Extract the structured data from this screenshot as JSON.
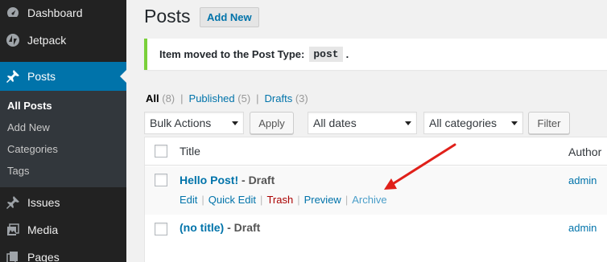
{
  "sidebar": {
    "items": [
      {
        "label": "Dashboard",
        "icon": "dashboard-icon"
      },
      {
        "label": "Jetpack",
        "icon": "jetpack-icon"
      },
      {
        "label": "Posts",
        "icon": "pin-icon"
      },
      {
        "label": "Issues",
        "icon": "pin-icon"
      },
      {
        "label": "Media",
        "icon": "media-icon"
      },
      {
        "label": "Pages",
        "icon": "pages-icon"
      }
    ],
    "submenu": [
      "All Posts",
      "Add New",
      "Categories",
      "Tags"
    ],
    "accent": "#0073aa"
  },
  "header": {
    "title": "Posts",
    "add_new": "Add New"
  },
  "notice": {
    "text": "Item moved to the Post Type:",
    "code": "post",
    "suffix": ".",
    "border_color": "#7ad03a"
  },
  "filters": {
    "all": "All",
    "all_count": "(8)",
    "published": "Published",
    "published_count": "(5)",
    "drafts": "Drafts",
    "drafts_count": "(3)",
    "separator": "|"
  },
  "tablenav": {
    "bulk_actions": "Bulk Actions",
    "apply": "Apply",
    "dates": "All dates",
    "categories": "All categories",
    "filter": "Filter"
  },
  "table": {
    "columns": {
      "title": "Title",
      "author": "Author"
    },
    "rows": [
      {
        "title": "Hello Post!",
        "state": "- Draft",
        "author": "admin",
        "actions": [
          "Edit",
          "Quick Edit",
          "Trash",
          "Preview",
          "Archive"
        ]
      },
      {
        "title": "(no title)",
        "state": "- Draft",
        "author": "admin"
      }
    ],
    "action_sep": "|"
  },
  "annotation": {
    "arrow_color": "#e0201a",
    "arrow_target": "Archive"
  }
}
